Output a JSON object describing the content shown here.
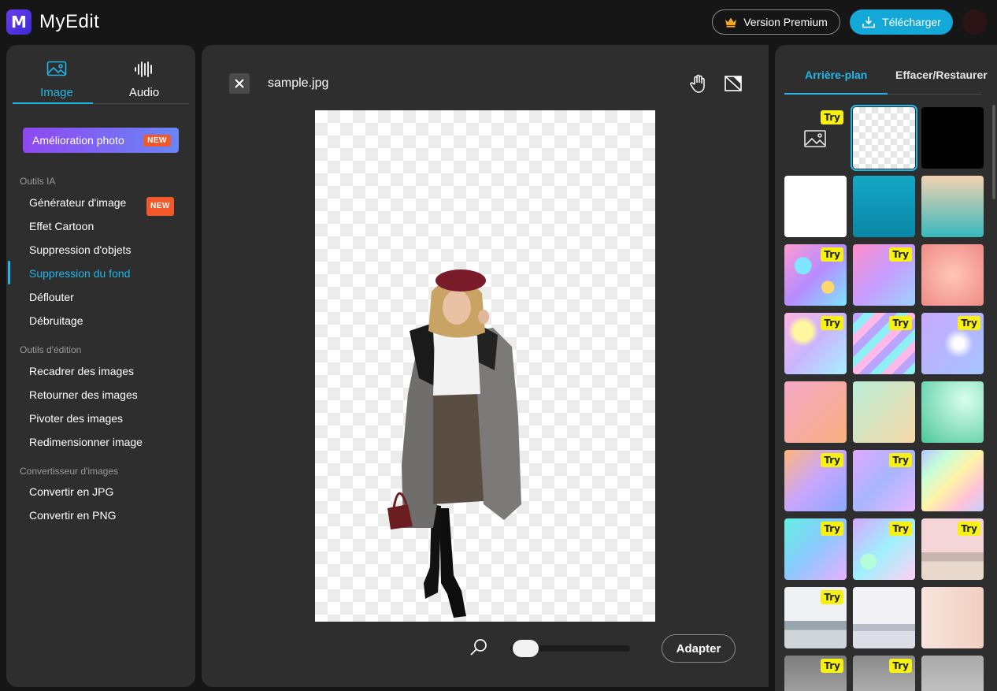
{
  "header": {
    "logo_letter": "M",
    "app_title": "MyEdit",
    "premium_label": "Version Premium",
    "download_label": "Télécharger"
  },
  "left": {
    "tabs": [
      {
        "label": "Image",
        "active": true
      },
      {
        "label": "Audio",
        "active": false
      }
    ],
    "enhance_label": "Amélioration photo",
    "new_badge": "NEW",
    "sections": [
      {
        "title": "Outils IA",
        "items": [
          "Générateur d'image",
          "Effet Cartoon",
          "Suppression d'objets",
          "Suppression du fond",
          "Déflouter",
          "Débruitage"
        ]
      },
      {
        "title": "Outils d'édition",
        "items": [
          "Recadrer des images",
          "Retourner des images",
          "Pivoter des images",
          "Redimensionner image"
        ]
      },
      {
        "title": "Convertisseur d'images",
        "items": [
          "Convertir en JPG",
          "Convertir en PNG"
        ]
      }
    ],
    "active_item": "Suppression du fond"
  },
  "center": {
    "filename": "sample.jpg",
    "adapt_label": "Adapter",
    "zoom_level": 0.05
  },
  "right": {
    "tabs": [
      "Arrière-plan",
      "Effacer/Restaurer"
    ],
    "try_label": "Try",
    "backgrounds": [
      {
        "kind": "upload",
        "try": true
      },
      {
        "kind": "transparent",
        "try": false,
        "selected": true
      },
      {
        "kind": "black",
        "try": false
      },
      {
        "kind": "white",
        "try": false
      },
      {
        "kind": "teal",
        "try": false
      },
      {
        "kind": "peach-teal",
        "try": false
      },
      {
        "kind": "holo-bubbles",
        "try": true
      },
      {
        "kind": "glitter-pink",
        "try": true
      },
      {
        "kind": "glitter-coral",
        "try": false
      },
      {
        "kind": "bokeh-pastel",
        "try": true
      },
      {
        "kind": "liquid-holo",
        "try": true
      },
      {
        "kind": "hearts-bokeh",
        "try": true
      },
      {
        "kind": "pink-gradient",
        "try": false
      },
      {
        "kind": "mint-peach",
        "try": false
      },
      {
        "kind": "mint-rays",
        "try": false
      },
      {
        "kind": "purple-orange-bokeh",
        "try": true
      },
      {
        "kind": "lilac-bokeh",
        "try": true
      },
      {
        "kind": "rainbow-diagonal",
        "try": false
      },
      {
        "kind": "aqua-holo",
        "try": true
      },
      {
        "kind": "bubbles-lilac",
        "try": true
      },
      {
        "kind": "beach-pink",
        "try": true
      },
      {
        "kind": "sea-grey",
        "try": true
      },
      {
        "kind": "fog-sea",
        "try": false
      },
      {
        "kind": "window-tree",
        "try": false
      },
      {
        "kind": "dark-sea",
        "try": true
      },
      {
        "kind": "dark-horizon",
        "try": true
      },
      {
        "kind": "grey-sky",
        "try": false
      }
    ]
  },
  "colors": {
    "accent": "#23b6e8",
    "try_badge": "#f6f112",
    "new_badge": "#f2582a"
  }
}
